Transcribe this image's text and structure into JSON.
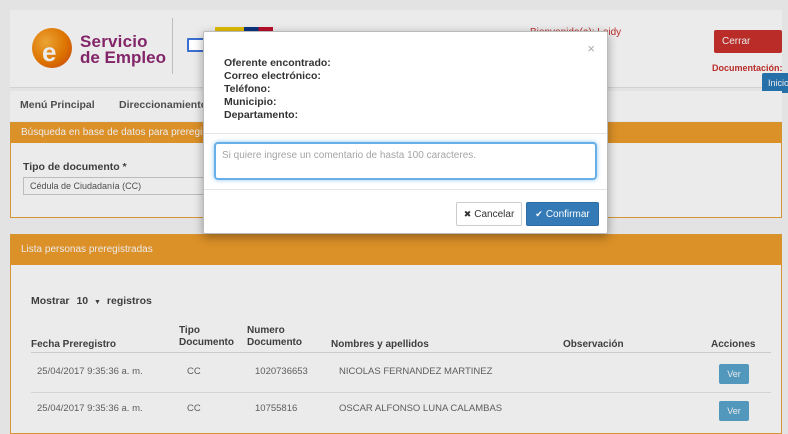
{
  "header": {
    "logo_line1": "Servicio",
    "logo_line2": "de Empleo",
    "welcome": "Bienvenido(a): Leidy",
    "logout_label": "Cerrar Sesión",
    "docs_label": "Documentación:",
    "home_label": "Inicio"
  },
  "nav": {
    "items": [
      "Menú Principal",
      "Direccionamiento"
    ]
  },
  "search_panel": {
    "title": "Búsqueda en base de datos para preregis",
    "doc_type_label": "Tipo de documento *",
    "doc_type_value": "Cédula de Ciudadanía (CC)"
  },
  "list_panel": {
    "title": "Lista personas preregistradas",
    "show_label": "Mostrar",
    "show_value": "10",
    "records_label": "registros",
    "columns": [
      "Fecha Preregistro",
      "Tipo Documento",
      "Numero Documento",
      "Nombres y apellidos",
      "Observación",
      "Acciones"
    ],
    "col_tipo_l1": "Tipo",
    "col_tipo_l2": "Documento",
    "col_num_l1": "Numero",
    "col_num_l2": "Documento",
    "rows": [
      {
        "fecha": "25/04/2017 9:35:36 a. m.",
        "tipo": "CC",
        "numero": "1020736653",
        "nombre": "NICOLAS FERNANDEZ MARTINEZ",
        "accion": "Ver"
      },
      {
        "fecha": "25/04/2017 9:35:36 a. m.",
        "tipo": "CC",
        "numero": "10755816",
        "nombre": "OSCAR ALFONSO LUNA CALAMBAS",
        "accion": "Ver"
      }
    ]
  },
  "modal": {
    "close": "×",
    "lines": [
      "Oferente encontrado:",
      "Correo electrónico:",
      "Teléfono:",
      "Municipio:",
      "Departamento:"
    ],
    "comment_placeholder": "Si quiere ingrese un comentario de hasta 100 caracteres.",
    "cancel_label": "Cancelar",
    "confirm_label": "Confirmar"
  },
  "icons": {
    "arrow": "arrow-right-icon",
    "cancel": "times-icon",
    "confirm": "check-icon"
  },
  "colors": {
    "orange": "#ee9d2c",
    "primary": "#337ab7",
    "danger": "#c9302c"
  }
}
